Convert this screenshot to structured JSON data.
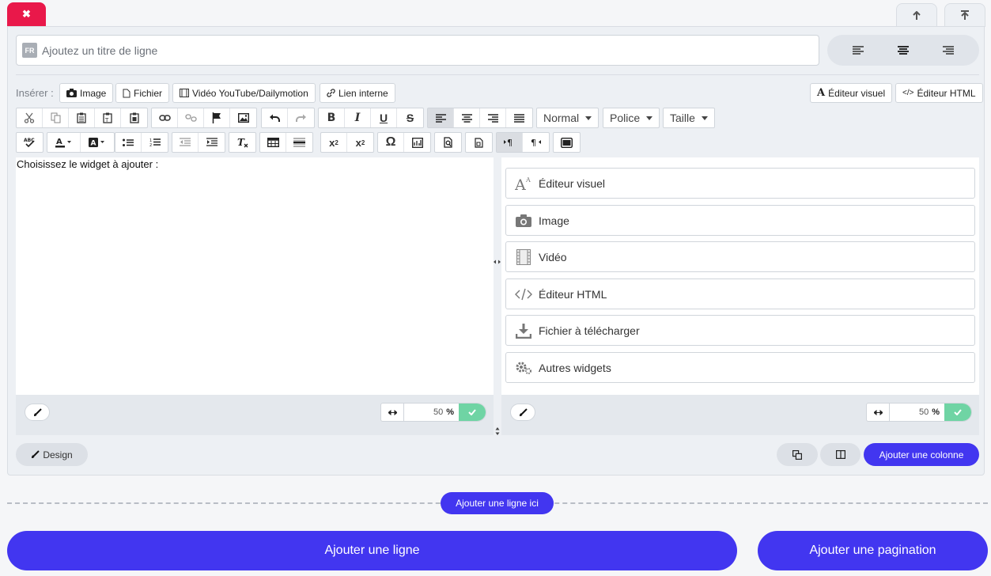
{
  "tabs": {
    "close_symbol": "✖"
  },
  "row": {
    "lang_badge": "FR",
    "title_placeholder": "Ajoutez un titre de ligne",
    "title_value": ""
  },
  "insert": {
    "label": "Insérer :",
    "buttons": [
      "Image",
      "Fichier",
      "Vidéo YouTube/Dailymotion",
      "Lien interne"
    ]
  },
  "editor_modes": {
    "visual": "Éditeur visuel",
    "html": "Éditeur HTML"
  },
  "toolbar": {
    "format": "Normal",
    "font": "Police",
    "size": "Taille"
  },
  "editor": {
    "content": "Choisissez le widget à ajouter :"
  },
  "widgets": [
    "Éditeur visuel",
    "Image",
    "Vidéo",
    "Éditeur HTML",
    "Fichier à télécharger",
    "Autres widgets"
  ],
  "columns": [
    {
      "width": "50",
      "unit": "%"
    },
    {
      "width": "50",
      "unit": "%"
    }
  ],
  "actions": {
    "design": "Design",
    "add_column": "Ajouter une colonne",
    "add_line_here": "Ajouter une ligne ici",
    "add_line": "Ajouter une ligne",
    "add_pagination": "Ajouter une pagination"
  },
  "colors": {
    "accent": "#4236f0",
    "danger": "#e9184a",
    "success": "#6fd4a4",
    "panel": "#edf0f4"
  }
}
